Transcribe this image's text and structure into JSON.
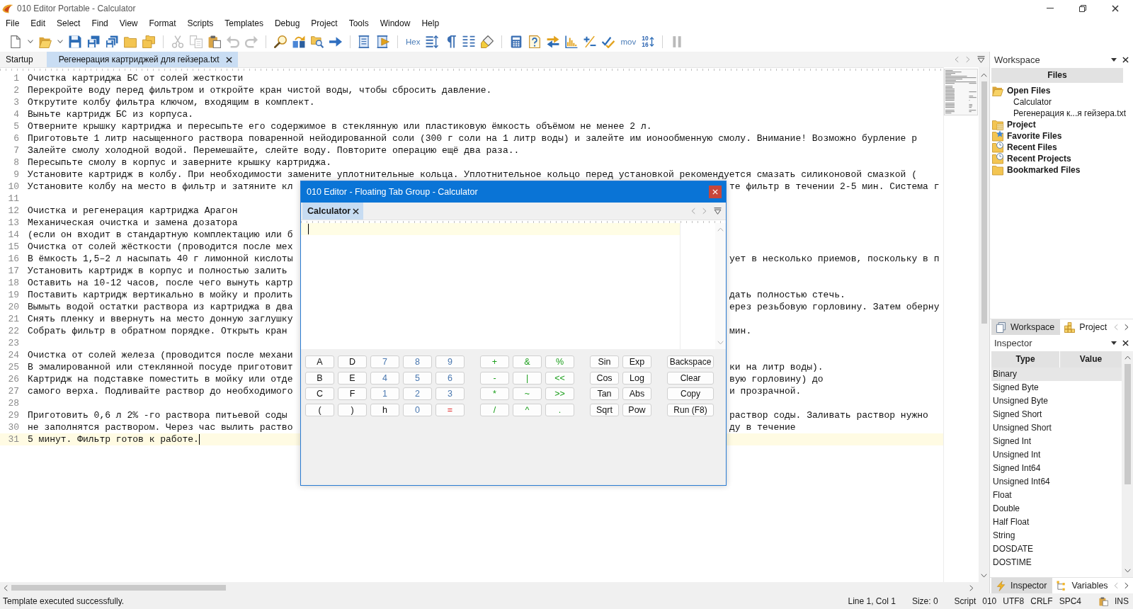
{
  "window": {
    "title": "010 Editor Portable - Calculator"
  },
  "menu": [
    "File",
    "Edit",
    "Select",
    "Find",
    "View",
    "Format",
    "Scripts",
    "Templates",
    "Debug",
    "Project",
    "Tools",
    "Window",
    "Help"
  ],
  "toolbar": {
    "groups": [
      {
        "items": [
          {
            "kind": "icon",
            "disabled": false
          },
          {
            "kind": "caret",
            "disabled": false
          },
          {
            "kind": "icon",
            "disabled": false
          },
          {
            "kind": "caret",
            "disabled": false
          },
          {
            "kind": "icon",
            "disabled": false
          },
          {
            "kind": "icon",
            "disabled": false
          },
          {
            "kind": "icon",
            "disabled": false
          },
          {
            "kind": "icon",
            "disabled": false
          },
          {
            "kind": "icon",
            "disabled": false
          }
        ]
      },
      {
        "items": [
          {
            "kind": "icon",
            "disabled": true
          },
          {
            "kind": "icon",
            "disabled": true
          },
          {
            "kind": "icon",
            "disabled": false
          },
          {
            "kind": "icon",
            "disabled": true
          },
          {
            "kind": "icon",
            "disabled": true
          }
        ]
      },
      {
        "items": [
          {
            "kind": "icon",
            "disabled": false
          },
          {
            "kind": "icon",
            "disabled": false
          },
          {
            "kind": "icon",
            "disabled": false
          },
          {
            "kind": "icon",
            "disabled": false
          }
        ]
      },
      {
        "items": [
          {
            "kind": "icon",
            "disabled": false
          },
          {
            "kind": "icon",
            "disabled": false
          }
        ]
      },
      {
        "items": [
          {
            "kind": "text",
            "label": "Hex",
            "disabled": false
          },
          {
            "kind": "icon",
            "disabled": false
          },
          {
            "kind": "icon",
            "disabled": false
          },
          {
            "kind": "icon",
            "disabled": false
          },
          {
            "kind": "icon",
            "disabled": false
          }
        ]
      },
      {
        "items": [
          {
            "kind": "icon",
            "disabled": false
          },
          {
            "kind": "icon",
            "disabled": false
          },
          {
            "kind": "icon",
            "disabled": false
          },
          {
            "kind": "icon",
            "disabled": false
          },
          {
            "kind": "icon",
            "disabled": false
          },
          {
            "kind": "icon",
            "disabled": false
          },
          {
            "kind": "text",
            "label": "mov",
            "disabled": false
          },
          {
            "kind": "stack",
            "labels": [
              "10",
              "16"
            ],
            "disabled": false
          }
        ]
      },
      {
        "items": [
          {
            "kind": "icon",
            "disabled": true
          }
        ]
      }
    ]
  },
  "tabs": [
    {
      "label": "Startup",
      "selected": false,
      "closable": false
    },
    {
      "label": "Регенерация картриджей для гейзера.txt",
      "selected": true,
      "closable": true
    }
  ],
  "editor": {
    "lines": [
      {
        "number": "1",
        "text": "Очистка картриджа БС от солей жесткости",
        "current": false
      },
      {
        "number": "2",
        "text": "Перекройте воду перед фильтром и откройте кран чистой воды, чтобы сбросить давление.",
        "current": false
      },
      {
        "number": "3",
        "text": "Открутите колбу фильтра ключом, входящим в комплект.",
        "current": false
      },
      {
        "number": "4",
        "text": "Выньте картридж БС из корпуса.",
        "current": false
      },
      {
        "number": "5",
        "text": "Отверните крышку картриджа и пересыпьте его содержимое в стеклянную или пластиковую ёмкость объёмом не менее 2 л.",
        "current": false
      },
      {
        "number": "6",
        "text": "Приготовьте 1 литр насыщенного раствора поваренной нейодированной соли (300 г соли на 1 литр воды) и залейте им ионообменную смолу. Внимание! Возможно бурление р",
        "current": false
      },
      {
        "number": "7",
        "text": "Залейте смолу холодной водой. Перемешайте, слейте воду. Повторите операцию ещё два раза..",
        "current": false
      },
      {
        "number": "8",
        "text": "Пересыпьте смолу в корпус и заверните крышку картриджа.",
        "current": false
      },
      {
        "number": "9",
        "text": "Установите картридж в колбу. При необходимости замените уплотнительные кольца. Уплотнительное кольцо перед установкой рекомендуется смазать силиконовой смазкой (",
        "current": false
      },
      {
        "number": "10",
        "text": "Установите колбу на место в фильтр и затяните кл",
        "text_after_window": "те фильтр в течении 2-5 мин. Система г",
        "current": false
      },
      {
        "number": "11",
        "current": false
      },
      {
        "number": "12",
        "text": "Очистка и регенерация картриджа Арагон",
        "current": false
      },
      {
        "number": "13",
        "text": "Механическая очистка и замена дозатора",
        "current": false
      },
      {
        "number": "14",
        "text": "(если он входит в стандартную комплектацию или б",
        "current": false
      },
      {
        "number": "15",
        "text": "Очистка от солей жёсткости (проводится после мех",
        "current": false
      },
      {
        "number": "16",
        "text": "В ёмкость 1,5–2 л насыпать 40 г лимонной кислоты",
        "text_after_window": "ует в несколько приемов, поскольку в п",
        "current": false
      },
      {
        "number": "17",
        "text": "Установить картридж в корпус и полностью залить",
        "current": false
      },
      {
        "number": "18",
        "text": "Оставить на 10-12 часов, после чего вынуть картр",
        "current": false
      },
      {
        "number": "19",
        "text": "Поставить картридж вертикально в мойку и пролить",
        "text_after_window": "дать полностью стечь.",
        "current": false
      },
      {
        "number": "20",
        "text": "Вымыть водой остатки раствора из картриджа в два",
        "text_after_window": "ерез резьбовую горловину. Затем оберну",
        "current": false
      },
      {
        "number": "21",
        "text": "Снять пленку и ввернуть на место донную заглушку",
        "current": false
      },
      {
        "number": "22",
        "text": "Собрать фильтр в обратном порядке. Открыть кран",
        "text_after_window": "мин.",
        "current": false
      },
      {
        "number": "23",
        "current": false
      },
      {
        "number": "24",
        "text": "Очистка от солей железа (проводится после механи",
        "current": false
      },
      {
        "number": "25",
        "text": "В эмалированной или стеклянной посуде приготовит",
        "text_after_window": "ки на литр воды).",
        "current": false
      },
      {
        "number": "26",
        "text": "Картридж на подставке поместить в мойку или отде",
        "text_after_window": "вую горловину) до",
        "current": false
      },
      {
        "number": "27",
        "text": "самого верха. Подливайте раствор до необходимого",
        "text_after_window": "и прозрачной.",
        "current": false
      },
      {
        "number": "28",
        "current": false
      },
      {
        "number": "29",
        "text": "Приготовить 0,6 л 2% -го раствора питьевой соды",
        "text_after_window": "раствор соды. Заливать раствор нужно",
        "current": false
      },
      {
        "number": "30",
        "text": "не заполнятся раствором. Через час вылить раство",
        "text_after_window": "ду в течение",
        "current": false
      },
      {
        "number": "31",
        "text": "5 минут. Фильтр готов к работе.",
        "current": true
      }
    ]
  },
  "workspace": {
    "title": "Workspace",
    "header": "Files",
    "tree": [
      {
        "label": "Open Files",
        "expanded": true,
        "children": [
          {
            "label": "Calculator"
          },
          {
            "label": "Регенерация к...я гейзера.txt"
          }
        ]
      },
      {
        "label": "Project",
        "expanded": false
      },
      {
        "label": "Favorite Files",
        "expanded": false
      },
      {
        "label": "Recent Files",
        "expanded": false
      },
      {
        "label": "Recent Projects",
        "expanded": false
      },
      {
        "label": "Bookmarked Files",
        "expanded": false
      }
    ],
    "tabs": [
      {
        "label": "Workspace",
        "selected": true
      },
      {
        "label": "Project",
        "selected": false
      }
    ]
  },
  "inspector": {
    "title": "Inspector",
    "columns": [
      "Type",
      "Value"
    ],
    "rows": [
      {
        "type": "Binary",
        "selected": true
      },
      {
        "type": "Signed Byte",
        "selected": false
      },
      {
        "type": "Unsigned Byte",
        "selected": false
      },
      {
        "type": "Signed Short",
        "selected": false
      },
      {
        "type": "Unsigned Short",
        "selected": false
      },
      {
        "type": "Signed Int",
        "selected": false
      },
      {
        "type": "Unsigned Int",
        "selected": false
      },
      {
        "type": "Signed Int64",
        "selected": false
      },
      {
        "type": "Unsigned Int64",
        "selected": false
      },
      {
        "type": "Float",
        "selected": false
      },
      {
        "type": "Double",
        "selected": false
      },
      {
        "type": "Half Float",
        "selected": false
      },
      {
        "type": "String",
        "selected": false
      },
      {
        "type": "DOSDATE",
        "selected": false
      },
      {
        "type": "DOSTIME",
        "selected": false
      }
    ],
    "tabs": [
      {
        "label": "Inspector",
        "selected": true
      },
      {
        "label": "Variables",
        "selected": false
      }
    ]
  },
  "status_bar": {
    "message": "Template executed successfully.",
    "fields": [
      "Line 1, Col 1",
      "Size: 0",
      "Script",
      "010",
      "UTF8",
      "CRLF",
      "SPC4",
      "INS"
    ]
  },
  "calculator": {
    "title": "010 Editor - Floating Tab Group - Calculator",
    "tabs": [
      {
        "label": "Calculator",
        "selected": true,
        "closable": true
      }
    ],
    "keypad": {
      "groups": [
        {
          "rows": [
            [
              {
                "label": "A",
                "kind": "letter"
              },
              {
                "label": "D",
                "kind": "letter"
              },
              {
                "label": "7",
                "kind": "digit"
              },
              {
                "label": "8",
                "kind": "digit"
              },
              {
                "label": "9",
                "kind": "digit"
              }
            ],
            [
              {
                "label": "B",
                "kind": "letter"
              },
              {
                "label": "E",
                "kind": "letter"
              },
              {
                "label": "4",
                "kind": "digit"
              },
              {
                "label": "5",
                "kind": "digit"
              },
              {
                "label": "6",
                "kind": "digit"
              }
            ],
            [
              {
                "label": "C",
                "kind": "letter"
              },
              {
                "label": "F",
                "kind": "letter"
              },
              {
                "label": "1",
                "kind": "digit"
              },
              {
                "label": "2",
                "kind": "digit"
              },
              {
                "label": "3",
                "kind": "digit"
              }
            ],
            [
              {
                "label": "(",
                "kind": "letter"
              },
              {
                "label": ")",
                "kind": "letter"
              },
              {
                "label": "h",
                "kind": "letter"
              },
              {
                "label": "0",
                "kind": "digit"
              },
              {
                "label": "=",
                "kind": "result"
              }
            ]
          ]
        },
        {
          "rows": [
            [
              {
                "label": "+",
                "kind": "operator"
              },
              {
                "label": "&",
                "kind": "operator"
              },
              {
                "label": "%",
                "kind": "operator"
              }
            ],
            [
              {
                "label": "-",
                "kind": "operator"
              },
              {
                "label": "|",
                "kind": "operator"
              },
              {
                "label": "<<",
                "kind": "operator"
              }
            ],
            [
              {
                "label": "*",
                "kind": "operator"
              },
              {
                "label": "~",
                "kind": "operator"
              },
              {
                "label": ">>",
                "kind": "operator"
              }
            ],
            [
              {
                "label": "/",
                "kind": "operator"
              },
              {
                "label": "^",
                "kind": "operator"
              },
              {
                "label": ".",
                "kind": "operator"
              }
            ]
          ]
        },
        {
          "rows": [
            [
              {
                "label": "Sin",
                "kind": "function"
              },
              {
                "label": "Exp",
                "kind": "function"
              }
            ],
            [
              {
                "label": "Cos",
                "kind": "function"
              },
              {
                "label": "Log",
                "kind": "function"
              }
            ],
            [
              {
                "label": "Tan",
                "kind": "function"
              },
              {
                "label": "Abs",
                "kind": "function"
              }
            ],
            [
              {
                "label": "Sqrt",
                "kind": "function"
              },
              {
                "label": "Pow",
                "kind": "function"
              }
            ]
          ]
        },
        {
          "rows": [
            [
              {
                "label": "Backspace",
                "kind": "command"
              }
            ],
            [
              {
                "label": "Clear",
                "kind": "command"
              }
            ],
            [
              {
                "label": "Copy",
                "kind": "command"
              }
            ],
            [
              {
                "label": "Run (F8)",
                "kind": "command"
              }
            ]
          ]
        }
      ]
    }
  }
}
